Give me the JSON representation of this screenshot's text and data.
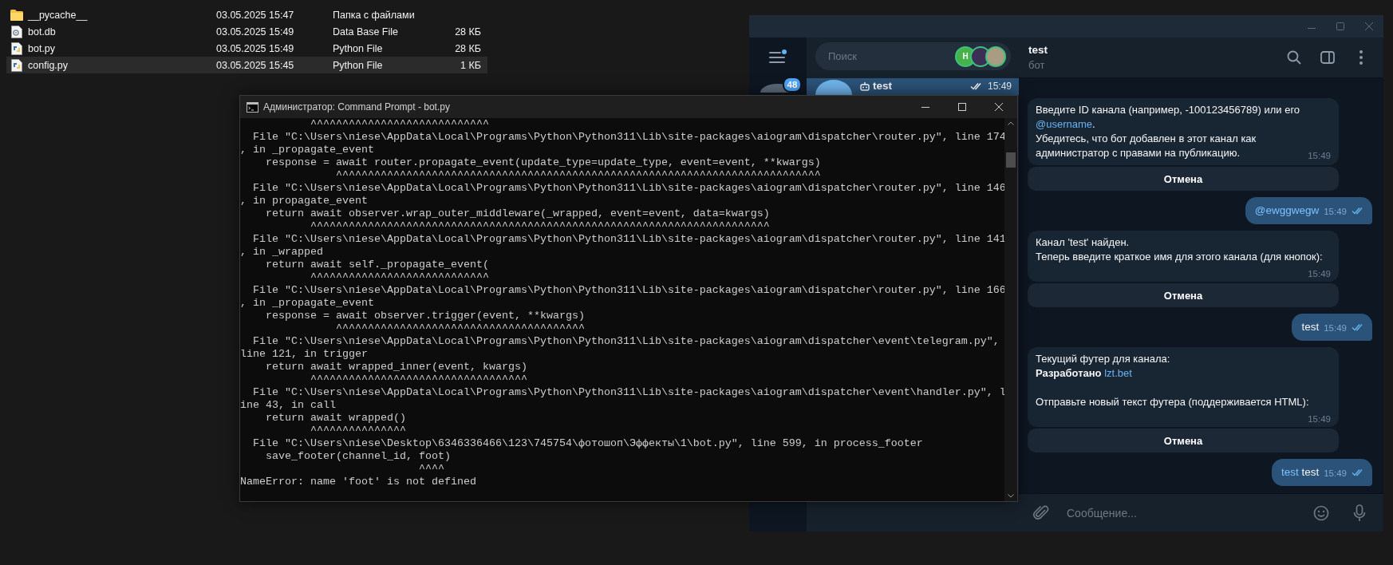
{
  "explorer": {
    "files": [
      {
        "name": "__pycache__",
        "modified": "03.05.2025 15:47",
        "type": "Папка с файлами",
        "kind": "folder",
        "selected": false
      },
      {
        "name": "bot.db",
        "modified": "03.05.2025 15:49",
        "type": "Data Base File",
        "size": "28 КБ",
        "kind": "database",
        "selected": false
      },
      {
        "name": "bot.py",
        "modified": "03.05.2025 15:49",
        "type": "Python File",
        "size": "28 КБ",
        "kind": "python",
        "selected": false
      },
      {
        "name": "config.py",
        "modified": "03.05.2025 15:45",
        "type": "Python File",
        "size": "1 КБ",
        "kind": "python",
        "selected": true
      }
    ]
  },
  "console": {
    "title": "Администратор: Command Prompt - bot.py",
    "lines": [
      "           ^^^^^^^^^^^^^^^^^^^^^^^^^^^^",
      "  File \"C:\\Users\\niese\\AppData\\Local\\Programs\\Python\\Python311\\Lib\\site-packages\\aiogram\\dispatcher\\router.py\", line 174",
      ", in _propagate_event",
      "    response = await router.propagate_event(update_type=update_type, event=event, **kwargs)",
      "               ^^^^^^^^^^^^^^^^^^^^^^^^^^^^^^^^^^^^^^^^^^^^^^^^^^^^^^^^^^^^^^^^^^^^^^^^^^^^",
      "  File \"C:\\Users\\niese\\AppData\\Local\\Programs\\Python\\Python311\\Lib\\site-packages\\aiogram\\dispatcher\\router.py\", line 146",
      ", in propagate_event",
      "    return await observer.wrap_outer_middleware(_wrapped, event=event, data=kwargs)",
      "           ^^^^^^^^^^^^^^^^^^^^^^^^^^^^^^^^^^^^^^^^^^^^^^^^^^^^^^^^^^^^^^^^^^^^^^^^",
      "  File \"C:\\Users\\niese\\AppData\\Local\\Programs\\Python\\Python311\\Lib\\site-packages\\aiogram\\dispatcher\\router.py\", line 141",
      ", in _wrapped",
      "    return await self._propagate_event(",
      "           ^^^^^^^^^^^^^^^^^^^^^^^^^^^^",
      "  File \"C:\\Users\\niese\\AppData\\Local\\Programs\\Python\\Python311\\Lib\\site-packages\\aiogram\\dispatcher\\router.py\", line 166",
      ", in _propagate_event",
      "    response = await observer.trigger(event, **kwargs)",
      "               ^^^^^^^^^^^^^^^^^^^^^^^^^^^^^^^^^^^^^^^",
      "  File \"C:\\Users\\niese\\AppData\\Local\\Programs\\Python\\Python311\\Lib\\site-packages\\aiogram\\dispatcher\\event\\telegram.py\",",
      "line 121, in trigger",
      "    return await wrapped_inner(event, kwargs)",
      "           ^^^^^^^^^^^^^^^^^^^^^^^^^^^^^^^^^^",
      "  File \"C:\\Users\\niese\\AppData\\Local\\Programs\\Python\\Python311\\Lib\\site-packages\\aiogram\\dispatcher\\event\\handler.py\", l",
      "ine 43, in call",
      "    return await wrapped()",
      "           ^^^^^^^^^^^^^^^",
      "  File \"C:\\Users\\niese\\Desktop\\6346336466\\123\\745754\\фотошоп\\Эффекты\\1\\bot.py\", line 599, in process_footer",
      "    save_footer(channel_id, foot)",
      "                            ^^^^",
      "NameError: name 'foot' is not defined"
    ]
  },
  "telegram": {
    "folder_badge": "48",
    "search": {
      "placeholder": "Поиск",
      "stories": [
        {
          "kind": "letter",
          "text": "Н"
        },
        {
          "kind": "photo"
        },
        {
          "kind": "photo"
        }
      ]
    },
    "chats": [
      {
        "name": "test",
        "time": "15:49",
        "selected": true,
        "read": true
      }
    ],
    "header": {
      "title": "test",
      "subtitle": "бот"
    },
    "messages": [
      {
        "kind": "incoming",
        "parts": [
          {
            "text": "Введите ID канала (например, -100123456789) или его "
          },
          {
            "kind": "link",
            "text": "@username"
          },
          {
            "text": ".\nУбедитесь, что бот добавлен в этот канал как администратор с правами на публикацию."
          }
        ],
        "time": "15:49",
        "buttons": [
          "Отмена"
        ]
      },
      {
        "kind": "outgoing",
        "parts": [
          {
            "kind": "link",
            "text": "@ewggwegw"
          }
        ],
        "time": "15:49",
        "read": true
      },
      {
        "kind": "incoming",
        "parts": [
          {
            "text": "Канал 'test' найден.\nТеперь введите краткое имя для этого канала (для кнопок):"
          }
        ],
        "time": "15:49",
        "buttons": [
          "Отмена"
        ]
      },
      {
        "kind": "outgoing",
        "parts": [
          {
            "text": "test"
          }
        ],
        "time": "15:49",
        "read": true
      },
      {
        "kind": "incoming",
        "parts": [
          {
            "text": "Текущий футер для канала:\n**Разработано** "
          },
          {
            "kind": "link",
            "text": "lzt.bet"
          },
          {
            "text": "\n\nОтправьте новый текст футера (поддерживается HTML):"
          }
        ],
        "time": "15:49",
        "buttons": [
          "Отмена"
        ]
      },
      {
        "kind": "outgoing",
        "parts": [
          {
            "kind": "link",
            "text": "test"
          },
          {
            "text": " test"
          }
        ],
        "time": "15:49",
        "read": true
      }
    ],
    "composer": {
      "placeholder": "Сообщение..."
    }
  }
}
